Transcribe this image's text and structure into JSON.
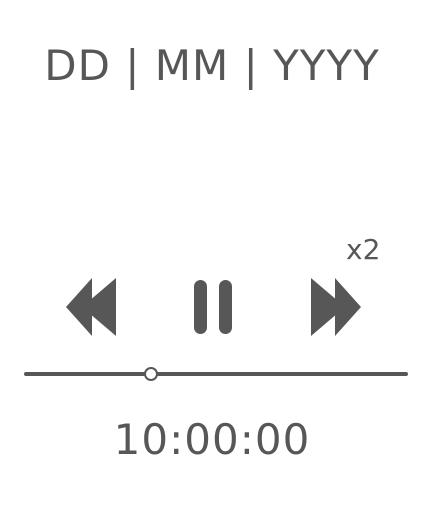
{
  "date_format": "DD | MM | YYYY",
  "speed": "x2",
  "controls": {
    "rewind_icon": "rewind-icon",
    "pause_icon": "pause-icon",
    "forward_icon": "fast-forward-icon"
  },
  "timeline": {
    "progress": 0.33
  },
  "time": "10:00:00",
  "colors": {
    "foreground": "#575757",
    "background": "#ffffff"
  }
}
